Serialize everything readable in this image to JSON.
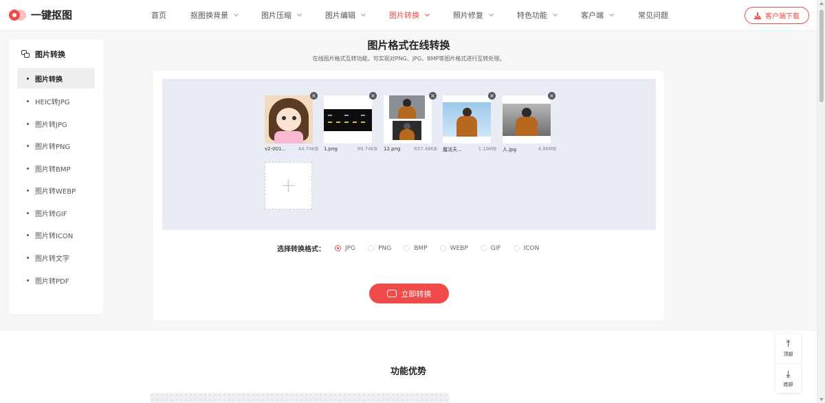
{
  "brand": {
    "name": "一键抠图"
  },
  "nav": {
    "items": [
      {
        "label": "首页",
        "dropdown": false
      },
      {
        "label": "抠图换背景",
        "dropdown": true
      },
      {
        "label": "图片压缩",
        "dropdown": true
      },
      {
        "label": "图片编辑",
        "dropdown": true
      },
      {
        "label": "图片转换",
        "dropdown": true,
        "active": true
      },
      {
        "label": "照片修复",
        "dropdown": true
      },
      {
        "label": "特色功能",
        "dropdown": true
      },
      {
        "label": "客户端",
        "dropdown": true
      },
      {
        "label": "常见问题",
        "dropdown": false
      }
    ],
    "download_label": "客户端下载"
  },
  "sidebar": {
    "title": "图片转换",
    "items": [
      {
        "label": "图片转换",
        "active": true
      },
      {
        "label": "HEIC转JPG"
      },
      {
        "label": "图片转JPG"
      },
      {
        "label": "图片转PNG"
      },
      {
        "label": "图片转BMP"
      },
      {
        "label": "图片转WEBP"
      },
      {
        "label": "图片转GIF"
      },
      {
        "label": "图片转ICON"
      },
      {
        "label": "图片转文字"
      },
      {
        "label": "图片转PDF"
      }
    ]
  },
  "main": {
    "title": "图片格式在线转换",
    "subtitle": "在线图片格式互转功能，可实现对PNG、JPG、BMP等图片格式进行互转处理。",
    "files": [
      {
        "name": "v2-001...",
        "size": "44.74KB"
      },
      {
        "name": "1.png",
        "size": "99.74KB"
      },
      {
        "name": "12.png",
        "size": "657.48KB"
      },
      {
        "name": "魔法天...",
        "size": "1.16MB"
      },
      {
        "name": "人.jpg",
        "size": "4.86MB"
      }
    ],
    "add_symbol": "+",
    "close_symbol": "×",
    "format_label": "选择转换格式：",
    "formats": [
      "JPG",
      "PNG",
      "BMP",
      "WEBP",
      "GIF",
      "ICON"
    ],
    "selected_format": "JPG",
    "convert_label": "立即转换"
  },
  "lower": {
    "title": "功能优势"
  },
  "float_tools": {
    "top_label": "顶部",
    "bottom_label": "底部"
  },
  "colors": {
    "accent": "#f04a4a",
    "upload_bg": "#e9ecf4",
    "page_bg": "#f5f6f8"
  }
}
